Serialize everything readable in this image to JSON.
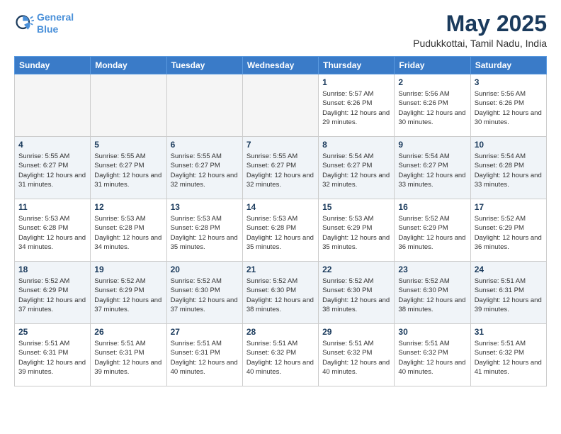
{
  "header": {
    "logo_line1": "General",
    "logo_line2": "Blue",
    "title": "May 2025",
    "subtitle": "Pudukkottai, Tamil Nadu, India"
  },
  "days_of_week": [
    "Sunday",
    "Monday",
    "Tuesday",
    "Wednesday",
    "Thursday",
    "Friday",
    "Saturday"
  ],
  "weeks": [
    [
      {
        "day": "",
        "empty": true
      },
      {
        "day": "",
        "empty": true
      },
      {
        "day": "",
        "empty": true
      },
      {
        "day": "",
        "empty": true
      },
      {
        "day": "1",
        "sunrise": "5:57 AM",
        "sunset": "6:26 PM",
        "daylight": "12 hours and 29 minutes."
      },
      {
        "day": "2",
        "sunrise": "5:56 AM",
        "sunset": "6:26 PM",
        "daylight": "12 hours and 30 minutes."
      },
      {
        "day": "3",
        "sunrise": "5:56 AM",
        "sunset": "6:26 PM",
        "daylight": "12 hours and 30 minutes."
      }
    ],
    [
      {
        "day": "4",
        "sunrise": "5:55 AM",
        "sunset": "6:27 PM",
        "daylight": "12 hours and 31 minutes."
      },
      {
        "day": "5",
        "sunrise": "5:55 AM",
        "sunset": "6:27 PM",
        "daylight": "12 hours and 31 minutes."
      },
      {
        "day": "6",
        "sunrise": "5:55 AM",
        "sunset": "6:27 PM",
        "daylight": "12 hours and 32 minutes."
      },
      {
        "day": "7",
        "sunrise": "5:55 AM",
        "sunset": "6:27 PM",
        "daylight": "12 hours and 32 minutes."
      },
      {
        "day": "8",
        "sunrise": "5:54 AM",
        "sunset": "6:27 PM",
        "daylight": "12 hours and 32 minutes."
      },
      {
        "day": "9",
        "sunrise": "5:54 AM",
        "sunset": "6:27 PM",
        "daylight": "12 hours and 33 minutes."
      },
      {
        "day": "10",
        "sunrise": "5:54 AM",
        "sunset": "6:28 PM",
        "daylight": "12 hours and 33 minutes."
      }
    ],
    [
      {
        "day": "11",
        "sunrise": "5:53 AM",
        "sunset": "6:28 PM",
        "daylight": "12 hours and 34 minutes."
      },
      {
        "day": "12",
        "sunrise": "5:53 AM",
        "sunset": "6:28 PM",
        "daylight": "12 hours and 34 minutes."
      },
      {
        "day": "13",
        "sunrise": "5:53 AM",
        "sunset": "6:28 PM",
        "daylight": "12 hours and 35 minutes."
      },
      {
        "day": "14",
        "sunrise": "5:53 AM",
        "sunset": "6:28 PM",
        "daylight": "12 hours and 35 minutes."
      },
      {
        "day": "15",
        "sunrise": "5:53 AM",
        "sunset": "6:29 PM",
        "daylight": "12 hours and 35 minutes."
      },
      {
        "day": "16",
        "sunrise": "5:52 AM",
        "sunset": "6:29 PM",
        "daylight": "12 hours and 36 minutes."
      },
      {
        "day": "17",
        "sunrise": "5:52 AM",
        "sunset": "6:29 PM",
        "daylight": "12 hours and 36 minutes."
      }
    ],
    [
      {
        "day": "18",
        "sunrise": "5:52 AM",
        "sunset": "6:29 PM",
        "daylight": "12 hours and 37 minutes."
      },
      {
        "day": "19",
        "sunrise": "5:52 AM",
        "sunset": "6:29 PM",
        "daylight": "12 hours and 37 minutes."
      },
      {
        "day": "20",
        "sunrise": "5:52 AM",
        "sunset": "6:30 PM",
        "daylight": "12 hours and 37 minutes."
      },
      {
        "day": "21",
        "sunrise": "5:52 AM",
        "sunset": "6:30 PM",
        "daylight": "12 hours and 38 minutes."
      },
      {
        "day": "22",
        "sunrise": "5:52 AM",
        "sunset": "6:30 PM",
        "daylight": "12 hours and 38 minutes."
      },
      {
        "day": "23",
        "sunrise": "5:52 AM",
        "sunset": "6:30 PM",
        "daylight": "12 hours and 38 minutes."
      },
      {
        "day": "24",
        "sunrise": "5:51 AM",
        "sunset": "6:31 PM",
        "daylight": "12 hours and 39 minutes."
      }
    ],
    [
      {
        "day": "25",
        "sunrise": "5:51 AM",
        "sunset": "6:31 PM",
        "daylight": "12 hours and 39 minutes."
      },
      {
        "day": "26",
        "sunrise": "5:51 AM",
        "sunset": "6:31 PM",
        "daylight": "12 hours and 39 minutes."
      },
      {
        "day": "27",
        "sunrise": "5:51 AM",
        "sunset": "6:31 PM",
        "daylight": "12 hours and 40 minutes."
      },
      {
        "day": "28",
        "sunrise": "5:51 AM",
        "sunset": "6:32 PM",
        "daylight": "12 hours and 40 minutes."
      },
      {
        "day": "29",
        "sunrise": "5:51 AM",
        "sunset": "6:32 PM",
        "daylight": "12 hours and 40 minutes."
      },
      {
        "day": "30",
        "sunrise": "5:51 AM",
        "sunset": "6:32 PM",
        "daylight": "12 hours and 40 minutes."
      },
      {
        "day": "31",
        "sunrise": "5:51 AM",
        "sunset": "6:32 PM",
        "daylight": "12 hours and 41 minutes."
      }
    ]
  ]
}
